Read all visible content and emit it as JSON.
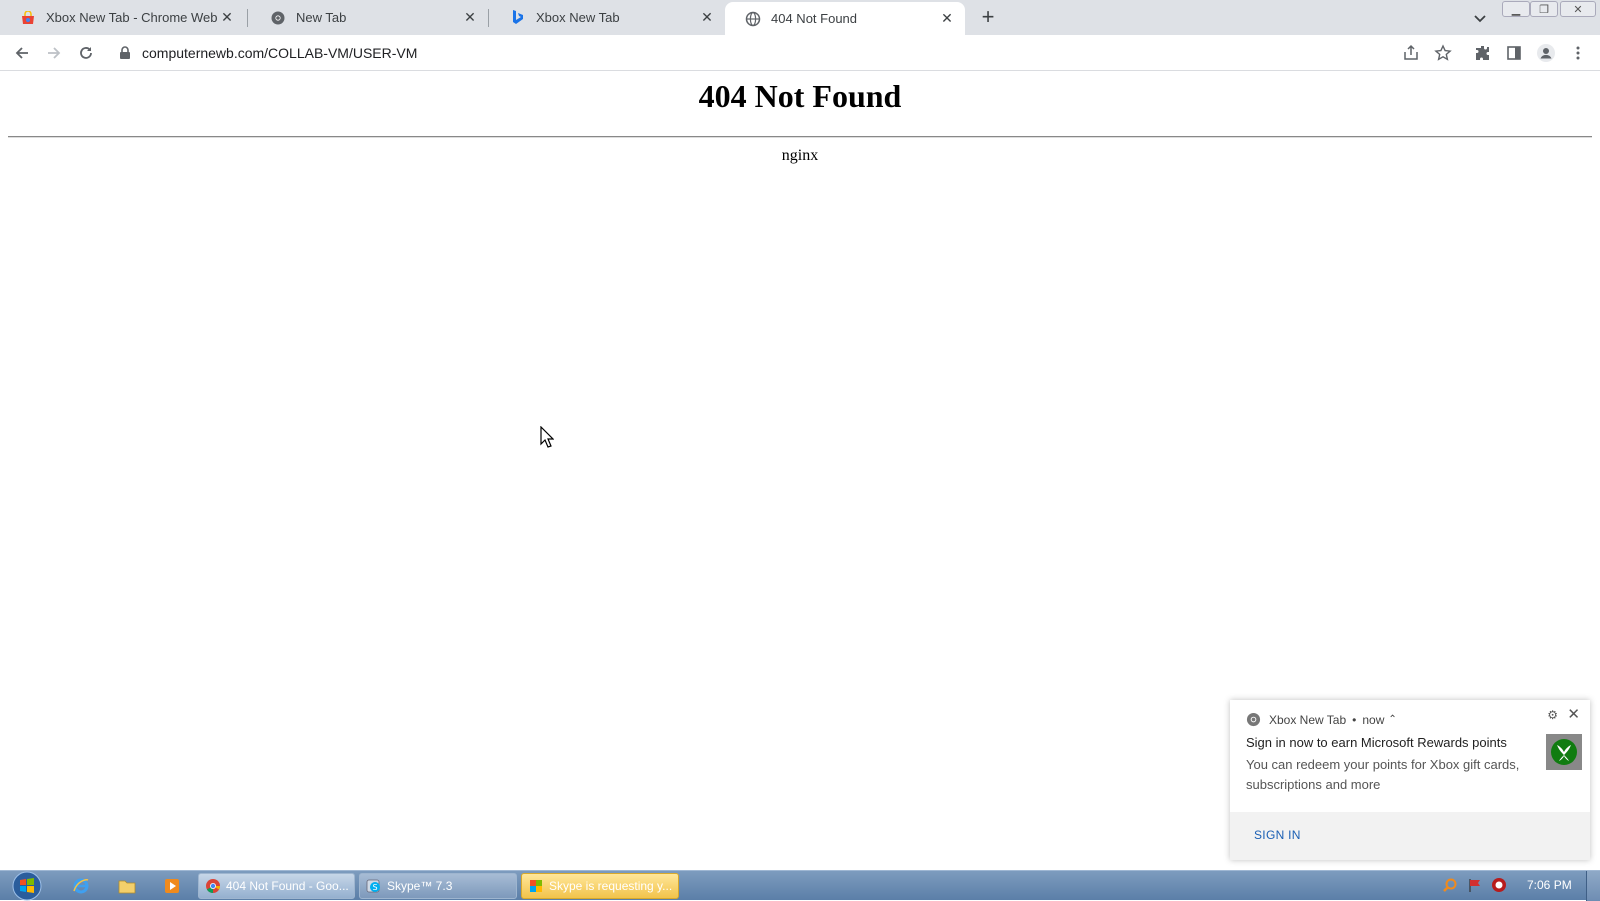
{
  "browser": {
    "tabs": [
      {
        "title": "Xbox New Tab - Chrome Web Sto",
        "icon": "chrome-web-store-icon",
        "active": false
      },
      {
        "title": "New Tab",
        "icon": "chrome-icon",
        "active": false
      },
      {
        "title": "Xbox New Tab",
        "icon": "bing-icon",
        "active": false
      },
      {
        "title": "404 Not Found",
        "icon": "globe-icon",
        "active": true
      }
    ],
    "url": "computernewb.com/COLLAB-VM/USER-VM"
  },
  "page": {
    "heading": "404 Not Found",
    "server": "nginx"
  },
  "notification": {
    "app": "Xbox New Tab",
    "time": "now",
    "title": "Sign in now to earn Microsoft Rewards points",
    "body": "You can redeem your points for Xbox gift cards, subscriptions and more",
    "action": "SIGN IN"
  },
  "taskbar": {
    "buttons": [
      {
        "label": "404 Not Found - Goo...",
        "icon": "chrome-icon"
      },
      {
        "label": "Skype™ 7.3",
        "icon": "skype-icon"
      },
      {
        "label": "Skype is requesting y...",
        "icon": "skype-flag-icon"
      }
    ],
    "clock": "7:06 PM"
  },
  "colors": {
    "tabstrip": "#dee1e6",
    "taskbar": "#6b8bb1",
    "link": "#1a5fb4",
    "flash": "#f2c34b"
  }
}
